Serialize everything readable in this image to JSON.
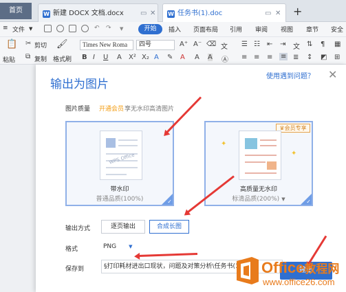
{
  "tabs": {
    "home": "首页",
    "doc1": "新建 DOCX 文档.docx",
    "doc2": "任务书(1).doc",
    "add": "+"
  },
  "menu": {
    "file": "文件",
    "start": "开始",
    "items": [
      "插入",
      "页面布局",
      "引用",
      "审阅",
      "视图",
      "章节",
      "安全"
    ]
  },
  "toolbar": {
    "cut": "剪切",
    "copy": "复制",
    "paste": "粘贴",
    "format_painter": "格式刷",
    "font_name": "Times New Roma",
    "font_size": "四号"
  },
  "dialog": {
    "title": "输出为图片",
    "help": "使用遇到问题？",
    "quality_label": "图片质量",
    "vip_link": "开通会员",
    "vip_desc": "享无水印高清图片",
    "option_a": {
      "name": "带水印",
      "sub": "普通品质(100%)",
      "watermark": "WPS Office"
    },
    "option_b": {
      "name": "高质量无水印",
      "sub": "标清品质(200%)",
      "badge": "会员专享"
    },
    "mode_label": "输出方式",
    "mode_single": "逐页输出",
    "mode_long": "合成长图",
    "format_label": "格式",
    "format_value": "PNG",
    "save_label": "保存到",
    "save_path": "§打印耗材进出口现状，问题及对策分析\\任务书(1",
    "export_button": "输出"
  },
  "watermark": {
    "brand": "Office",
    "suffix": "教程网",
    "url": "www.office26.com"
  },
  "colors": {
    "accent": "#2f6fd0",
    "vip": "#f39c12",
    "arrow": "#e53935"
  }
}
